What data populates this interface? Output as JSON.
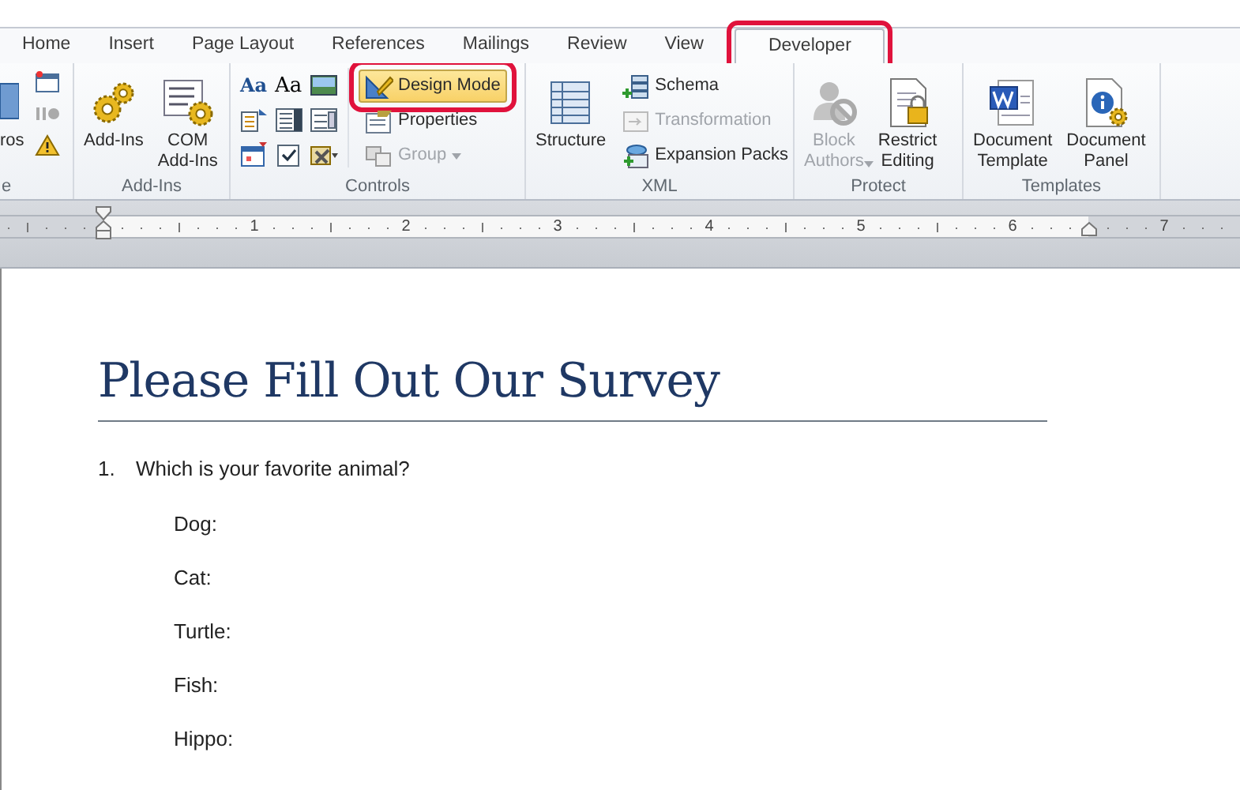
{
  "tabs": [
    {
      "label": "Home",
      "selected": false,
      "highlighted": false
    },
    {
      "label": "Insert",
      "selected": false,
      "highlighted": false
    },
    {
      "label": "Page Layout",
      "selected": false,
      "highlighted": false
    },
    {
      "label": "References",
      "selected": false,
      "highlighted": false
    },
    {
      "label": "Mailings",
      "selected": false,
      "highlighted": false
    },
    {
      "label": "Review",
      "selected": false,
      "highlighted": false
    },
    {
      "label": "View",
      "selected": false,
      "highlighted": false
    },
    {
      "label": "Developer",
      "selected": true,
      "highlighted": true
    }
  ],
  "ribbon_groups": [
    {
      "label": "e",
      "items": [
        {
          "kind": "large",
          "label": "ros",
          "disabled": false
        }
      ]
    },
    {
      "label": "Add-Ins",
      "items": [
        {
          "kind": "large",
          "label": "Add-Ins",
          "disabled": false
        },
        {
          "kind": "large",
          "label": "COM Add-Ins",
          "disabled": false
        }
      ]
    },
    {
      "label": "Controls",
      "glyphs": [
        "Aa",
        "Aa"
      ],
      "items": [
        {
          "kind": "small",
          "label": "Design Mode",
          "disabled": false,
          "on": true,
          "highlighted": true
        },
        {
          "kind": "small",
          "label": "Properties",
          "disabled": false,
          "on": false,
          "highlighted": false
        },
        {
          "kind": "small",
          "label": "Group",
          "disabled": true,
          "on": false,
          "highlighted": false,
          "dropdown": true
        }
      ]
    },
    {
      "label": "XML",
      "items": [
        {
          "kind": "large",
          "label": "Structure",
          "disabled": false
        },
        {
          "kind": "small",
          "label": "Schema",
          "disabled": false
        },
        {
          "kind": "small",
          "label": "Transformation",
          "disabled": true
        },
        {
          "kind": "small",
          "label": "Expansion Packs",
          "disabled": false
        }
      ]
    },
    {
      "label": "Protect",
      "items": [
        {
          "kind": "large",
          "label": "Block Authors",
          "disabled": true,
          "dropdown": true
        },
        {
          "kind": "large",
          "label": "Restrict Editing",
          "disabled": false
        }
      ]
    },
    {
      "label": "Templates",
      "items": [
        {
          "kind": "large",
          "label": "Document Template",
          "disabled": false
        },
        {
          "kind": "large",
          "label": "Document Panel",
          "disabled": false
        }
      ]
    }
  ],
  "ruler": {
    "numbers": [
      "1",
      "2",
      "3",
      "4",
      "5",
      "6",
      "7"
    ]
  },
  "document": {
    "title": "Please Fill Out Our Survey",
    "questions": [
      {
        "number": "1.",
        "text": "Which is your favorite animal?",
        "options": [
          "Dog:",
          "Cat:",
          "Turtle:",
          "Fish:",
          "Hippo:"
        ]
      }
    ]
  }
}
